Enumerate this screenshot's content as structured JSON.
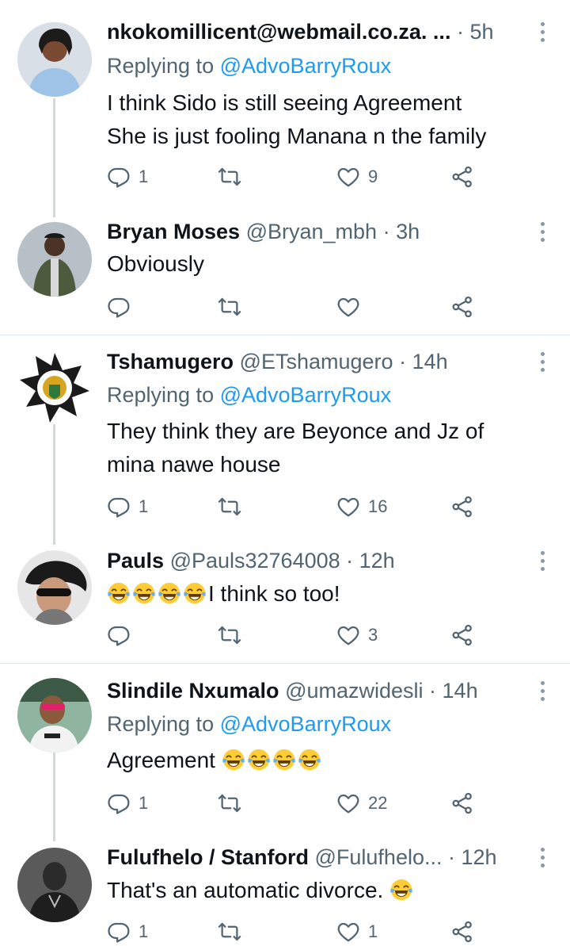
{
  "colors": {
    "link": "#1d9bf0",
    "secondary": "#536471",
    "text": "#0f1419",
    "thread": "#cfd9de",
    "divider": "#e1e8ed"
  },
  "tweets": [
    {
      "name": "",
      "handle": "nkokomillicent@webmail.co.za. ...",
      "time": "· 5h",
      "replying_prefix": "Replying to",
      "replying_handle": "@AdvoBarryRoux",
      "text_lines": [
        "I think Sido is still seeing Agreement",
        "She is just fooling Manana n the family"
      ],
      "reply_count": "1",
      "retweet_count": "",
      "like_count": "9"
    },
    {
      "name": "Bryan Moses",
      "handle": "@Bryan_mbh",
      "time": "· 3h",
      "text_lines": [
        "Obviously"
      ],
      "reply_count": "",
      "retweet_count": "",
      "like_count": ""
    },
    {
      "name": "Tshamugero",
      "handle": "@ETshamugero",
      "time": "· 14h",
      "replying_prefix": "Replying to",
      "replying_handle": "@AdvoBarryRoux",
      "text_lines": [
        "They think they are Beyonce and Jz of",
        "mina nawe house"
      ],
      "reply_count": "1",
      "retweet_count": "",
      "like_count": "16"
    },
    {
      "name": "Pauls",
      "handle": "@Pauls32764008",
      "time": "· 12h",
      "text": "I think so too!",
      "emoji_count": 4,
      "reply_count": "",
      "retweet_count": "",
      "like_count": "3"
    },
    {
      "name": "Slindile Nxumalo",
      "handle": "@umazwidesli",
      "time": "· 14h",
      "replying_prefix": "Replying to",
      "replying_handle": "@AdvoBarryRoux",
      "text": "Agreement",
      "emoji_count": 4,
      "reply_count": "1",
      "retweet_count": "",
      "like_count": "22"
    },
    {
      "name": "Fulufhelo / Stanford",
      "handle": "@Fulufhelo...",
      "time": "· 12h",
      "text": "That's an automatic divorce.",
      "emoji_count": 1,
      "reply_count": "1",
      "retweet_count": "",
      "like_count": "1"
    }
  ],
  "icons": [
    "reply-icon",
    "retweet-icon",
    "like-icon",
    "share-icon",
    "more-icon",
    "joy-emoji"
  ]
}
